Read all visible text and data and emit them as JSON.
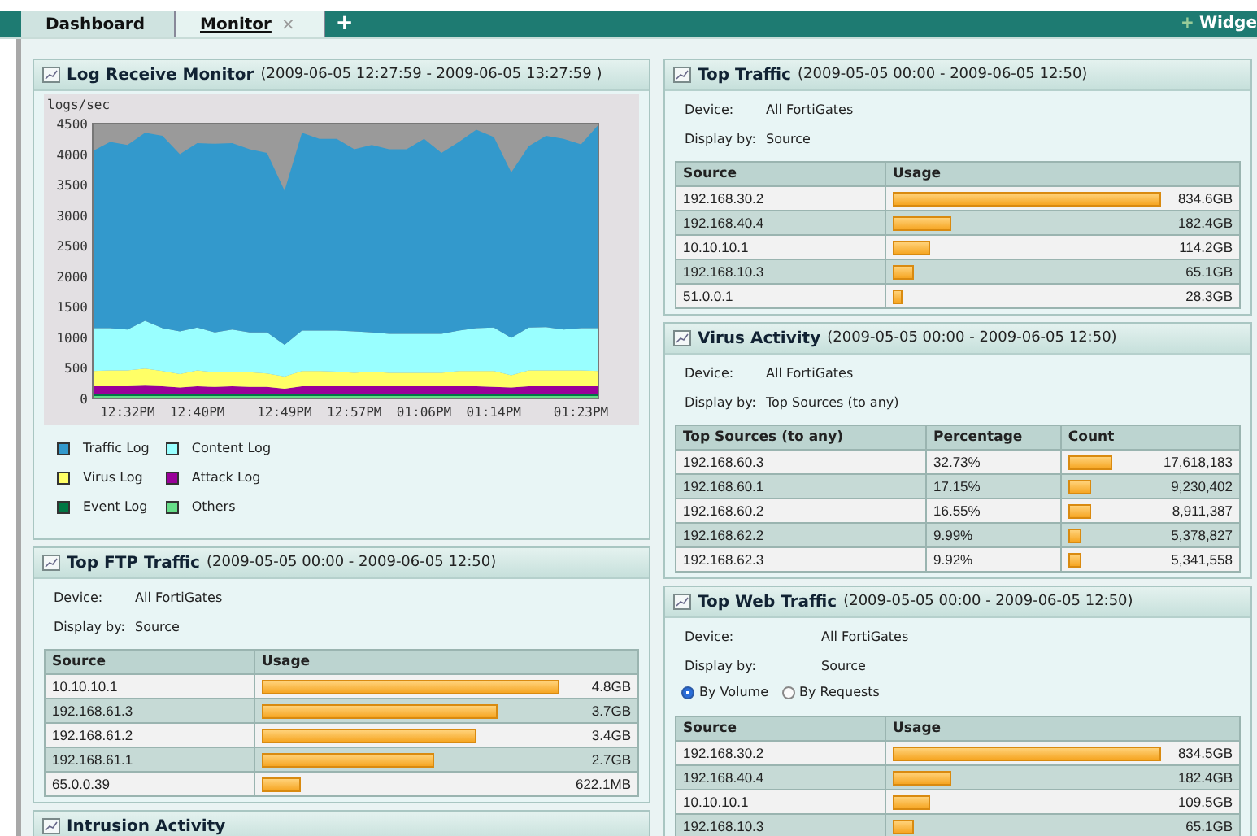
{
  "tabs": [
    {
      "label": "Dashboard",
      "selected": false
    },
    {
      "label": "Monitor",
      "selected": true,
      "close": "×"
    }
  ],
  "add_tab": "+",
  "widget_link": {
    "icon": "+",
    "label": "Widge"
  },
  "columns": [
    [
      {
        "kind": "chart",
        "title": "Log Receive Monitor",
        "range": "(2009-06-05 12:27:59 - 2009-06-05 13:27:59 )",
        "chart_data": {
          "type": "area",
          "stacked": true,
          "ylabel": "logs/sec",
          "ylim": [
            0,
            4500
          ],
          "yticks": [
            0,
            500,
            1000,
            1500,
            2000,
            2500,
            3000,
            3500,
            4000,
            4500
          ],
          "categories": [
            null,
            null,
            "12:32PM",
            null,
            null,
            null,
            "12:40PM",
            null,
            null,
            null,
            null,
            "12:49PM",
            null,
            null,
            null,
            "12:57PM",
            null,
            null,
            null,
            "01:06PM",
            null,
            null,
            null,
            "01:14PM",
            null,
            null,
            null,
            null,
            "01:23PM",
            null
          ],
          "series": [
            {
              "name": "Others",
              "color": "#66dd88",
              "values": [
                40,
                40,
                40,
                40,
                40,
                40,
                40,
                40,
                40,
                40,
                40,
                40,
                40,
                40,
                40,
                40,
                40,
                40,
                40,
                40,
                40,
                40,
                40,
                40,
                40,
                40,
                40,
                40,
                40,
                40
              ]
            },
            {
              "name": "Event Log",
              "color": "#007744",
              "values": [
                40,
                40,
                40,
                40,
                40,
                40,
                40,
                40,
                40,
                40,
                40,
                40,
                40,
                40,
                40,
                40,
                40,
                40,
                40,
                40,
                40,
                40,
                40,
                40,
                40,
                40,
                40,
                40,
                40,
                40
              ]
            },
            {
              "name": "Attack Log",
              "color": "#990099",
              "values": [
                120,
                120,
                120,
                130,
                120,
                100,
                120,
                110,
                120,
                110,
                110,
                80,
                120,
                120,
                120,
                120,
                120,
                120,
                120,
                120,
                120,
                120,
                120,
                110,
                100,
                120,
                120,
                120,
                120,
                120
              ]
            },
            {
              "name": "Virus Log",
              "color": "#ffff66",
              "values": [
                250,
                260,
                260,
                280,
                250,
                220,
                260,
                240,
                240,
                240,
                220,
                200,
                250,
                250,
                240,
                220,
                240,
                220,
                220,
                220,
                220,
                250,
                250,
                260,
                200,
                260,
                260,
                260,
                260,
                250
              ]
            },
            {
              "name": "Content Log",
              "color": "#99ffff",
              "values": [
                700,
                690,
                670,
                780,
                700,
                700,
                700,
                650,
                690,
                650,
                670,
                520,
                660,
                660,
                670,
                680,
                640,
                640,
                640,
                640,
                640,
                660,
                700,
                710,
                610,
                700,
                710,
                670,
                690,
                700
              ]
            },
            {
              "name": "Traffic Log",
              "color": "#3399cc",
              "values": [
                2900,
                3050,
                3020,
                3080,
                3150,
                2900,
                3020,
                3090,
                3050,
                3000,
                2940,
                2520,
                3240,
                3140,
                3140,
                2980,
                3070,
                3020,
                3020,
                3190,
                2960,
                3090,
                3250,
                3120,
                2710,
                2970,
                3130,
                3120,
                3010,
                3330
              ]
            }
          ]
        }
      },
      {
        "kind": "table",
        "title": "Top FTP Traffic",
        "range": "(2009-05-05 00:00 - 2009-06-05 12:50)",
        "info": [
          {
            "label": "Device:",
            "value": "All FortiGates"
          },
          {
            "label": "Display by:",
            "value": "Source"
          }
        ],
        "columns": [
          "Source",
          "Usage"
        ],
        "rows": [
          {
            "cells": [
              "10.10.10.1"
            ],
            "value": "4.8GB"
          },
          {
            "cells": [
              "192.168.61.3"
            ],
            "value": "3.7GB"
          },
          {
            "cells": [
              "192.168.61.2"
            ],
            "value": "3.4GB"
          },
          {
            "cells": [
              "192.168.61.1"
            ],
            "value": "2.7GB"
          },
          {
            "cells": [
              "65.0.0.39"
            ],
            "value": "622.1MB"
          }
        ]
      },
      {
        "kind": "header",
        "title": "Intrusion Activity"
      }
    ],
    [
      {
        "kind": "table",
        "title": "Top Traffic",
        "range": "(2009-05-05 00:00 - 2009-06-05 12:50)",
        "info": [
          {
            "label": "Device:",
            "value": "All FortiGates"
          },
          {
            "label": "Display by:",
            "value": "Source"
          }
        ],
        "columns": [
          "Source",
          "Usage"
        ],
        "rows": [
          {
            "cells": [
              "192.168.30.2"
            ],
            "value": "834.6GB"
          },
          {
            "cells": [
              "192.168.40.4"
            ],
            "value": "182.4GB"
          },
          {
            "cells": [
              "10.10.10.1"
            ],
            "value": "114.2GB"
          },
          {
            "cells": [
              "192.168.10.3"
            ],
            "value": "65.1GB"
          },
          {
            "cells": [
              "51.0.0.1"
            ],
            "value": "28.3GB"
          }
        ]
      },
      {
        "kind": "table",
        "title": "Virus Activity",
        "range": "(2009-05-05 00:00 - 2009-06-05 12:50)",
        "info": [
          {
            "label": "Device:",
            "value": "All FortiGates"
          },
          {
            "label": "Display by:",
            "value": "Top Sources (to any)"
          }
        ],
        "columns": [
          "Top Sources (to any)",
          "Percentage",
          "Count"
        ],
        "rows": [
          {
            "cells": [
              "192.168.60.3",
              "32.73%"
            ],
            "value": "17,618,183"
          },
          {
            "cells": [
              "192.168.60.1",
              "17.15%"
            ],
            "value": "9,230,402"
          },
          {
            "cells": [
              "192.168.60.2",
              "16.55%"
            ],
            "value": "8,911,387"
          },
          {
            "cells": [
              "192.168.62.2",
              "9.99%"
            ],
            "value": "5,378,827"
          },
          {
            "cells": [
              "192.168.62.3",
              "9.92%"
            ],
            "value": "5,341,558"
          }
        ]
      },
      {
        "kind": "table",
        "title": "Top Web Traffic",
        "range": "(2009-05-05 00:00 - 2009-06-05 12:50)",
        "info": [
          {
            "label": "Device:",
            "value": "All FortiGates"
          },
          {
            "label": "Display by:",
            "value": "Source"
          }
        ],
        "options": [
          {
            "label": "By Volume",
            "selected": true
          },
          {
            "label": "By Requests",
            "selected": false
          }
        ],
        "columns": [
          "Source",
          "Usage"
        ],
        "rows": [
          {
            "cells": [
              "192.168.30.2"
            ],
            "value": "834.5GB"
          },
          {
            "cells": [
              "192.168.40.4"
            ],
            "value": "182.4GB"
          },
          {
            "cells": [
              "10.10.10.1"
            ],
            "value": "109.5GB"
          },
          {
            "cells": [
              "192.168.10.3"
            ],
            "value": "65.1GB"
          }
        ]
      }
    ]
  ]
}
